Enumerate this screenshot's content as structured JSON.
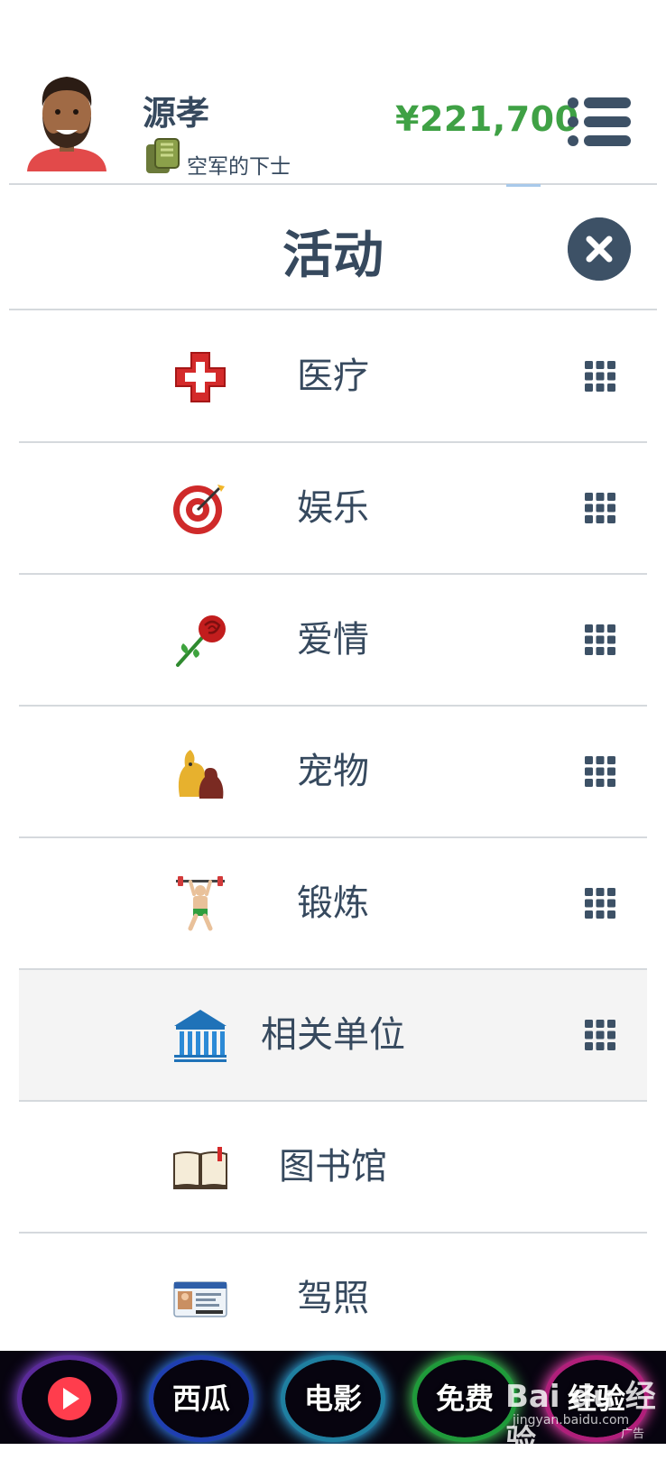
{
  "header": {
    "player_name": "源孝",
    "rank": "空军的下士",
    "money": "¥221,700"
  },
  "panel": {
    "title": "活动"
  },
  "activities": [
    {
      "label": "医疗",
      "icon": "medical-cross-icon",
      "grid": true
    },
    {
      "label": "娱乐",
      "icon": "target-icon",
      "grid": true
    },
    {
      "label": "爱情",
      "icon": "rose-icon",
      "grid": true
    },
    {
      "label": "宠物",
      "icon": "pets-icon",
      "grid": true
    },
    {
      "label": "锻炼",
      "icon": "weightlifter-icon",
      "grid": true
    },
    {
      "label": "相关单位",
      "icon": "government-building-icon",
      "grid": true
    },
    {
      "label": "图书馆",
      "icon": "open-book-icon",
      "grid": false
    },
    {
      "label": "驾照",
      "icon": "license-card-icon",
      "grid": false
    }
  ],
  "ad_bar": {
    "buttons": [
      "西瓜",
      "电影",
      "免费",
      "经验"
    ],
    "watermark": "Bai du 经验",
    "watermark_url": "jingyan.baidu.com",
    "ad_tag": "广告"
  },
  "colors": {
    "text": "#36495e",
    "money": "#3fa145",
    "close_button": "#3d5166",
    "active_row": "#f4f4f4"
  }
}
